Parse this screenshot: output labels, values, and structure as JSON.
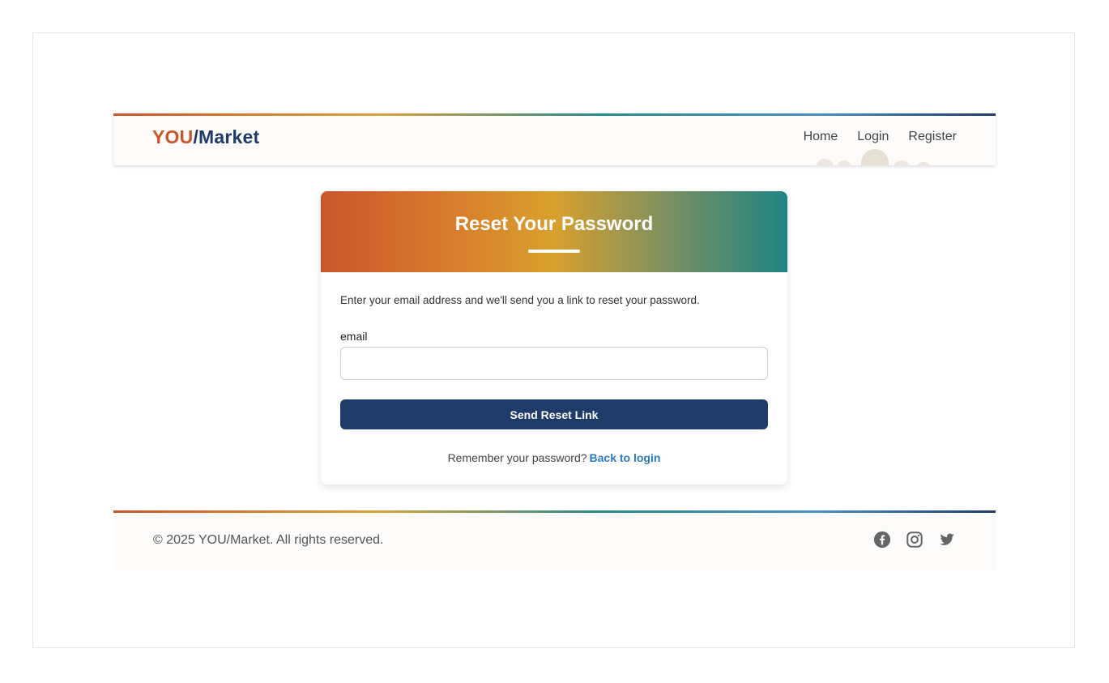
{
  "header": {
    "logo_part1": "YOU",
    "logo_part2": "/Market",
    "nav": {
      "home": "Home",
      "login": "Login",
      "register": "Register"
    }
  },
  "card": {
    "title": "Reset Your Password",
    "intro": "Enter your email address and we'll send you a link to reset your password.",
    "email_label": "email",
    "email_value": "",
    "email_placeholder": "",
    "send_button": "Send Reset Link",
    "remember_text": "Remember your password?",
    "back_link": "Back to login"
  },
  "footer": {
    "copyright": "© 2025 YOU/Market. All rights reserved.",
    "socials": [
      "facebook-icon",
      "instagram-icon",
      "twitter-icon"
    ]
  },
  "colors": {
    "brand_orange": "#c9562b",
    "brand_navy": "#1f3b69",
    "link_blue": "#2a7bbf",
    "icon_gray": "#666666"
  }
}
